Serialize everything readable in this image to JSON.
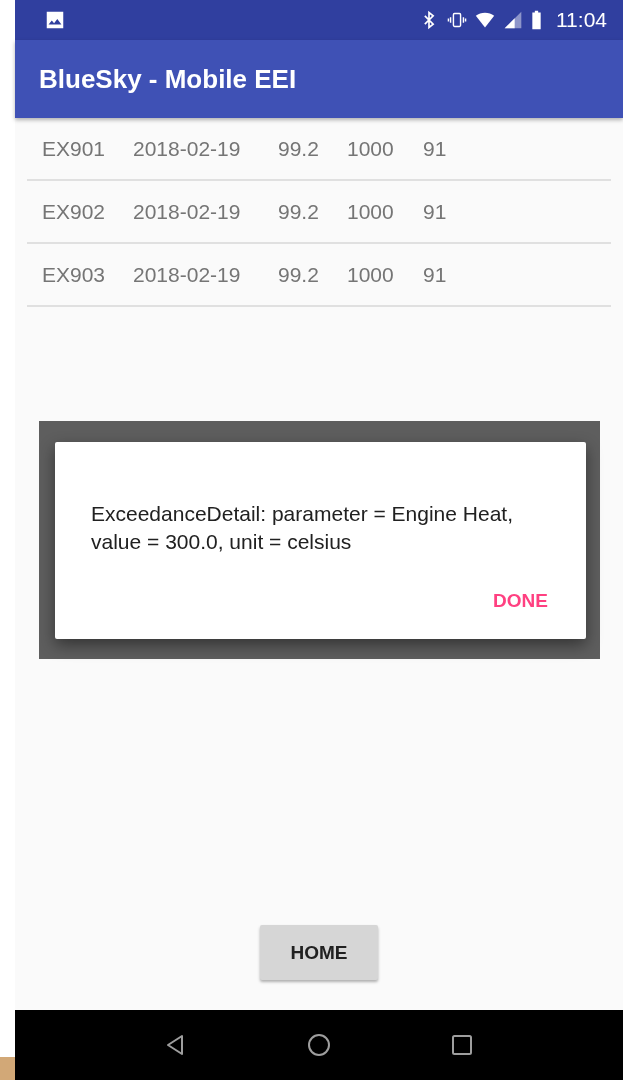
{
  "status_bar": {
    "time": "11:04"
  },
  "app_bar": {
    "title": "BlueSky - Mobile EEI"
  },
  "rows": [
    {
      "cells": [
        "EX901",
        "2018-02-19",
        "99.2",
        "1000",
        "91"
      ]
    },
    {
      "cells": [
        "EX902",
        "2018-02-19",
        "99.2",
        "1000",
        "91"
      ]
    },
    {
      "cells": [
        "EX903",
        "2018-02-19",
        "99.2",
        "1000",
        "91"
      ]
    }
  ],
  "dialog": {
    "message": "ExceedanceDetail: parameter = Engine Heat, value = 300.0, unit = celsius",
    "button": "DONE"
  },
  "home_button": "HOME"
}
